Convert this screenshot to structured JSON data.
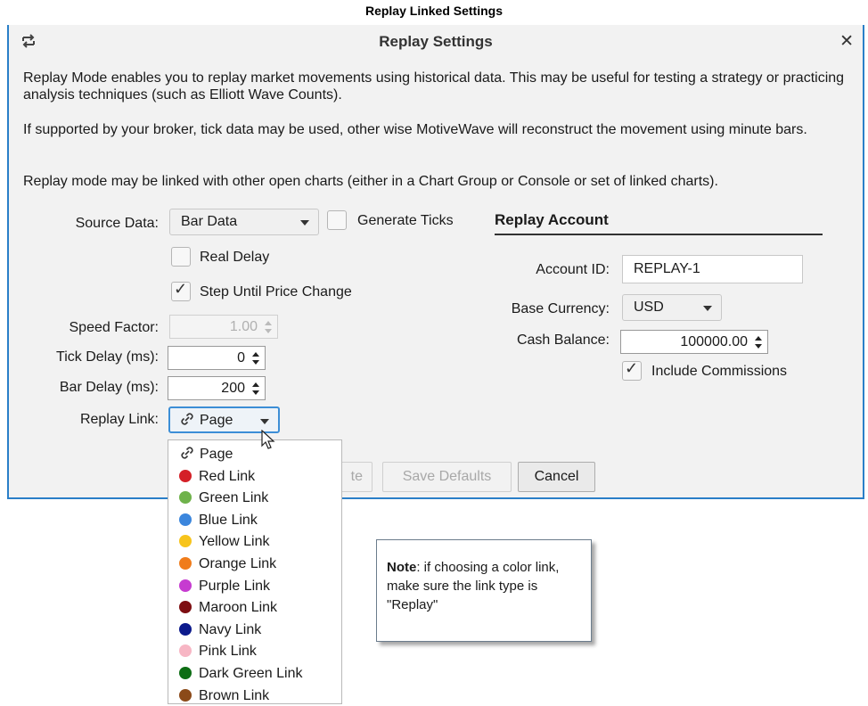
{
  "page_title": "Replay Linked Settings",
  "dialog": {
    "title": "Replay Settings",
    "close_symbol": "✕",
    "icons": {
      "title": "refresh-icon",
      "close": "close-icon"
    },
    "paragraphs": [
      "Replay Mode enables you to replay market movements using historical data.  This may be useful for testing a strategy or practicing analysis techniques (such as Elliott Wave Counts).",
      "If supported by your broker, tick data may be used, other wise MotiveWave will reconstruct the movement using minute bars.",
      "Replay mode may be linked with other open charts (either in a Chart Group or Console or set of linked charts)."
    ]
  },
  "form": {
    "source_data_label": "Source Data:",
    "source_data_value": "Bar Data",
    "generate_ticks": {
      "label": "Generate Ticks",
      "checked": false
    },
    "real_delay": {
      "label": "Real Delay",
      "checked": false
    },
    "step_until_price_change": {
      "label": "Step Until Price Change",
      "checked": true
    },
    "speed_factor_label": "Speed Factor:",
    "speed_factor_value": "1.00",
    "tick_delay_label": "Tick Delay (ms):",
    "tick_delay_value": "0",
    "bar_delay_label": "Bar Delay (ms):",
    "bar_delay_value": "200",
    "replay_link_label": "Replay Link:",
    "replay_link_value": "Page"
  },
  "account": {
    "section_title": "Replay Account",
    "account_id_label": "Account ID:",
    "account_id_value": "REPLAY-1",
    "base_currency_label": "Base Currency:",
    "base_currency_value": "USD",
    "cash_balance_label": "Cash Balance:",
    "cash_balance_value": "100000.00",
    "include_commissions": {
      "label": "Include Commissions",
      "checked": true
    }
  },
  "buttons": {
    "partial_label": "te",
    "save_defaults": "Save Defaults",
    "cancel": "Cancel"
  },
  "dropdown": {
    "items": [
      {
        "label": "Page",
        "color": null,
        "icon": "link-icon"
      },
      {
        "label": "Red Link",
        "color": "#d42027"
      },
      {
        "label": "Green Link",
        "color": "#6fb24b"
      },
      {
        "label": "Blue Link",
        "color": "#3b86dd"
      },
      {
        "label": "Yellow Link",
        "color": "#f7c41c"
      },
      {
        "label": "Orange Link",
        "color": "#f07c1a"
      },
      {
        "label": "Purple Link",
        "color": "#c63bd0"
      },
      {
        "label": "Maroon Link",
        "color": "#7d0e12"
      },
      {
        "label": "Navy Link",
        "color": "#0c1a8c"
      },
      {
        "label": "Pink Link",
        "color": "#f7b6c4"
      },
      {
        "label": "Dark Green Link",
        "color": "#0d6d14"
      },
      {
        "label": "Brown Link",
        "color": "#8b4a19"
      }
    ]
  },
  "note": {
    "bold": "Note",
    "text": ": if choosing a color link, make sure the link type is \"Replay\""
  },
  "colors": {
    "dialog_border": "#2a7fc8",
    "dialog_bg": "#f2f2f2"
  }
}
